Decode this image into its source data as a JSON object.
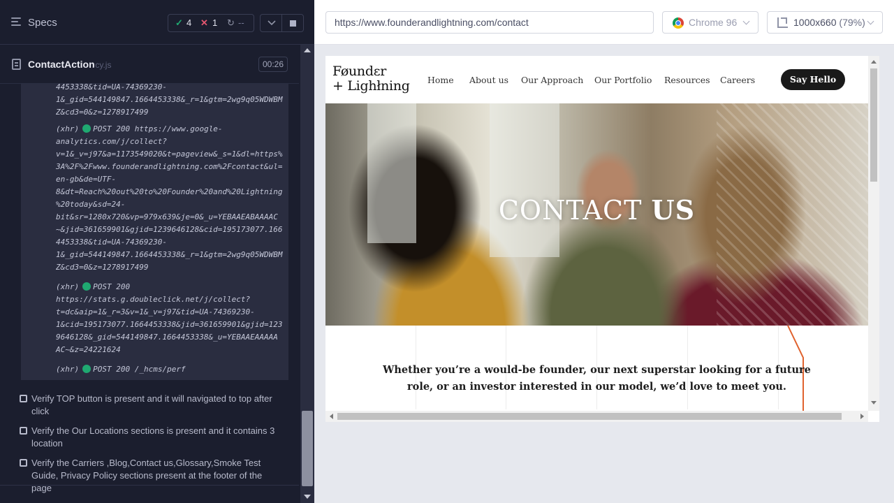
{
  "sidebar": {
    "title": "Specs",
    "stats": {
      "passed": "4",
      "failed": "1",
      "pending": "--"
    },
    "spec": {
      "name": "ContactAction",
      "ext": ".cy.js",
      "duration": "00:26"
    },
    "log": {
      "fragment": "4453338&tid=UA-74369230-\n1&_gid=544149847.1664453338&_r=1&gtm=2wg9q05WDWBM\nZ&cd3=0&z=1278917499",
      "entries": [
        {
          "head": "(xhr)",
          "method": "POST 200 https://www.google-",
          "url": "analytics.com/j/collect?\nv=1&_v=j97&a=1173549020&t=pageview&_s=1&dl=https%\n3A%2F%2Fwww.founderandlightning.com%2Fcontact&ul=\nen-gb&de=UTF-\n8&dt=Reach%20out%20to%20Founder%20and%20Lightning\n%20today&sd=24-\nbit&sr=1280x720&vp=979x639&je=0&_u=YEBAAEABAAAAC\n~&jid=361659901&gjid=1239646128&cid=195173077.166\n4453338&tid=UA-74369230-\n1&_gid=544149847.1664453338&_r=1&gtm=2wg9q05WDWBM\nZ&cd3=0&z=1278917499"
        },
        {
          "head": "(xhr)",
          "method": "POST 200",
          "url": "https://stats.g.doubleclick.net/j/collect?\nt=dc&aip=1&_r=3&v=1&_v=j97&tid=UA-74369230-\n1&cid=195173077.1664453338&jid=361659901&gjid=123\n9646128&_gid=544149847.1664453338&_u=YEBAAEAAAAA\nAC~&z=24221624"
        },
        {
          "head": "(xhr)",
          "method": "POST 200 /_hcms/perf",
          "url": ""
        }
      ]
    },
    "tests": [
      "Verify TOP button is present and it will navigated to top after click",
      "Verify the Our Locations sections is present and it contains 3 location",
      "Verify the Carriers ,Blog,Contact us,Glossary,Smoke Test Guide, Privacy Policy sections present at the footer of the page"
    ]
  },
  "browser": {
    "url": "https://www.founderandlightning.com/contact",
    "browser_label": "Chrome 96",
    "viewport": "1000x660",
    "zoom": "(79%)"
  },
  "site": {
    "logo_line1": "Føundɛr",
    "logo_line2": "+ Lighłning",
    "nav": [
      "Home",
      "About us",
      "Our Approach",
      "Our Portfolio",
      "Resources",
      "Careers"
    ],
    "cta": "Say Hello",
    "hero_title_light": "CONTACT ",
    "hero_title_bold": "US",
    "intro": "Whether you’re a would-be founder, our next superstar looking for a future role, or an investor interested in our model, we’d love to meet you."
  },
  "colors": {
    "pass": "#1fa971",
    "fail": "#e45770",
    "accent": "#e0622e",
    "panel": "#1b1e2e"
  }
}
